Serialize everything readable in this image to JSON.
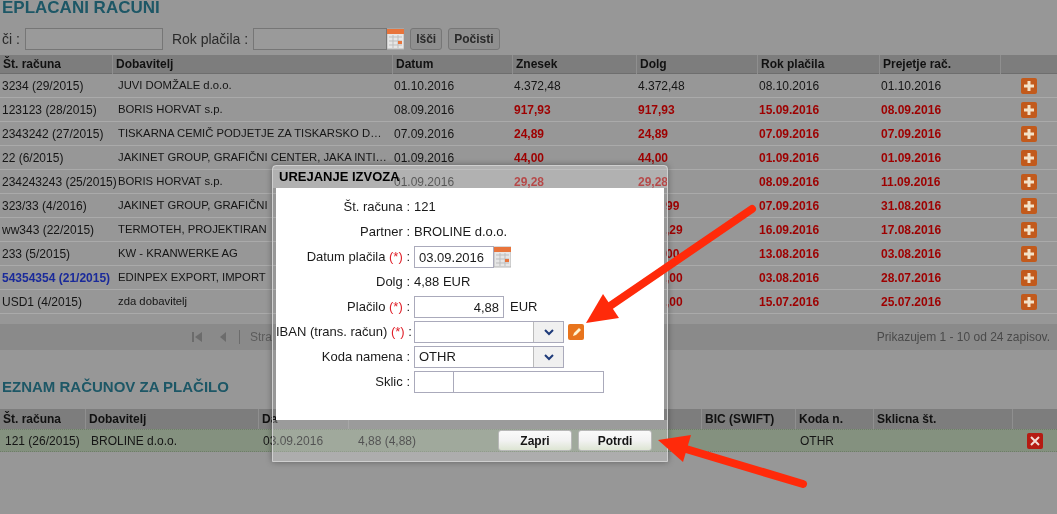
{
  "page_title": "EPLACANI RACUNI",
  "search": {
    "label": "či :",
    "due_label": "Rok plačila :",
    "buttons": [
      "Išči",
      "Počisti"
    ]
  },
  "invoices": {
    "columns": [
      "Št. računa",
      "Dobavitelj",
      "Datum",
      "Znesek",
      "Dolg",
      "Rok plačila",
      "Prejetje rač."
    ],
    "rows": [
      {
        "number": "3234 (29/2015)",
        "supplier": "JUVI DOMŽALE d.o.o.",
        "date": "01.10.2016",
        "amount": "4.372,48",
        "debt": "4.372,48",
        "due": "08.10.2016",
        "received": "01.10.2016",
        "overdue": false,
        "linked": false
      },
      {
        "number": "123123 (28/2015)",
        "supplier": "BORIS HORVAT s.p.",
        "date": "08.09.2016",
        "amount": "917,93",
        "debt": "917,93",
        "due": "15.09.2016",
        "received": "08.09.2016",
        "overdue": true,
        "linked": false
      },
      {
        "number": "2343242 (27/2015)",
        "supplier": "TISKARNA CEMIČ PODJETJE ZA TISKARSKO D…",
        "date": "07.09.2016",
        "amount": "24,89",
        "debt": "24,89",
        "due": "07.09.2016",
        "received": "07.09.2016",
        "overdue": true,
        "linked": false
      },
      {
        "number": "22 (6/2015)",
        "supplier": "JAKINET GROUP, GRAFIČNI CENTER, JAKA INTI…",
        "date": "01.09.2016",
        "amount": "44,00",
        "debt": "44,00",
        "due": "01.09.2016",
        "received": "01.09.2016",
        "overdue": true,
        "linked": false
      },
      {
        "number": "234243243 (25/2015)",
        "supplier": "BORIS HORVAT s.p.",
        "date": "01.09.2016",
        "amount": "29,28",
        "debt": "29,28",
        "due": "08.09.2016",
        "received": "11.09.2016",
        "overdue": true,
        "linked": false
      },
      {
        "number": "323/33 (4/2016)",
        "supplier": "JAKINET GROUP, GRAFIČNI",
        "debt": "99",
        "due": "07.09.2016",
        "received": "31.08.2016",
        "overdue": true,
        "linked": false
      },
      {
        "number": "ww343 (22/2015)",
        "supplier": "TERMOTEH, PROJEKTIRAN",
        "debt": ",29",
        "due": "16.09.2016",
        "received": "17.08.2016",
        "overdue": true,
        "linked": false
      },
      {
        "number": "233 (5/2015)",
        "supplier": "KW - KRANWERKE AG",
        "debt": "00",
        "due": "13.08.2016",
        "received": "03.08.2016",
        "overdue": true,
        "linked": false
      },
      {
        "number": "54354354 (21/2015)",
        "supplier": "EDINPEX EXPORT, IMPORT",
        "debt": ",00",
        "due": "03.08.2016",
        "received": "28.07.2016",
        "overdue": true,
        "linked": true
      },
      {
        "number": "USD1 (4/2015)",
        "supplier": "zda dobavitelj",
        "debt": ",00",
        "due": "15.07.2016",
        "received": "25.07.2016",
        "overdue": true,
        "linked": false
      }
    ],
    "pager": {
      "page_label": "Stra",
      "summary": "Prikazujem 1 - 10 od 24 zapisov."
    }
  },
  "payment_list": {
    "title": "EZNAM RAČUNOV ZA PLAČILO",
    "columns": [
      "Št. računa",
      "Dobavitelj",
      "Da",
      "",
      "BIC (SWIFT)",
      "Koda n.",
      "Sklicna št."
    ],
    "rows": [
      {
        "cells": [
          "121 (26/2015)",
          "BROLINE d.o.o.",
          "03.09.2016",
          "4,88 (4,88)",
          "",
          "OTHR",
          ""
        ],
        "selected": true
      }
    ]
  },
  "dialog": {
    "title": "UREJANJE IZVOZA",
    "fields": [
      {
        "kind": "text",
        "label": "Št. računa",
        "label_end": ":",
        "value": "121"
      },
      {
        "kind": "text",
        "label": "Partner",
        "label_end": ":",
        "value": "BROLINE d.o.o."
      },
      {
        "kind": "date",
        "label": "Datum plačila",
        "required_mark": "(*)",
        "label_end": ":",
        "value": "03.09.2016"
      },
      {
        "kind": "text",
        "label": "Dolg",
        "label_end": ":",
        "value": "4,88 EUR"
      },
      {
        "kind": "amount",
        "label": "Plačilo",
        "required_mark": "(*)",
        "label_end": ":",
        "value": "4,88",
        "unit": "EUR"
      },
      {
        "kind": "select_edit",
        "label": "IBAN (trans. račun)",
        "required_mark": "(*)",
        "label_end": ":"
      },
      {
        "kind": "select",
        "label": "Koda namena",
        "label_end": ":",
        "value": "OTHR"
      },
      {
        "kind": "split",
        "label": "Sklic",
        "label_end": ":"
      }
    ],
    "buttons": [
      "Zapri",
      "Potrdi"
    ]
  }
}
